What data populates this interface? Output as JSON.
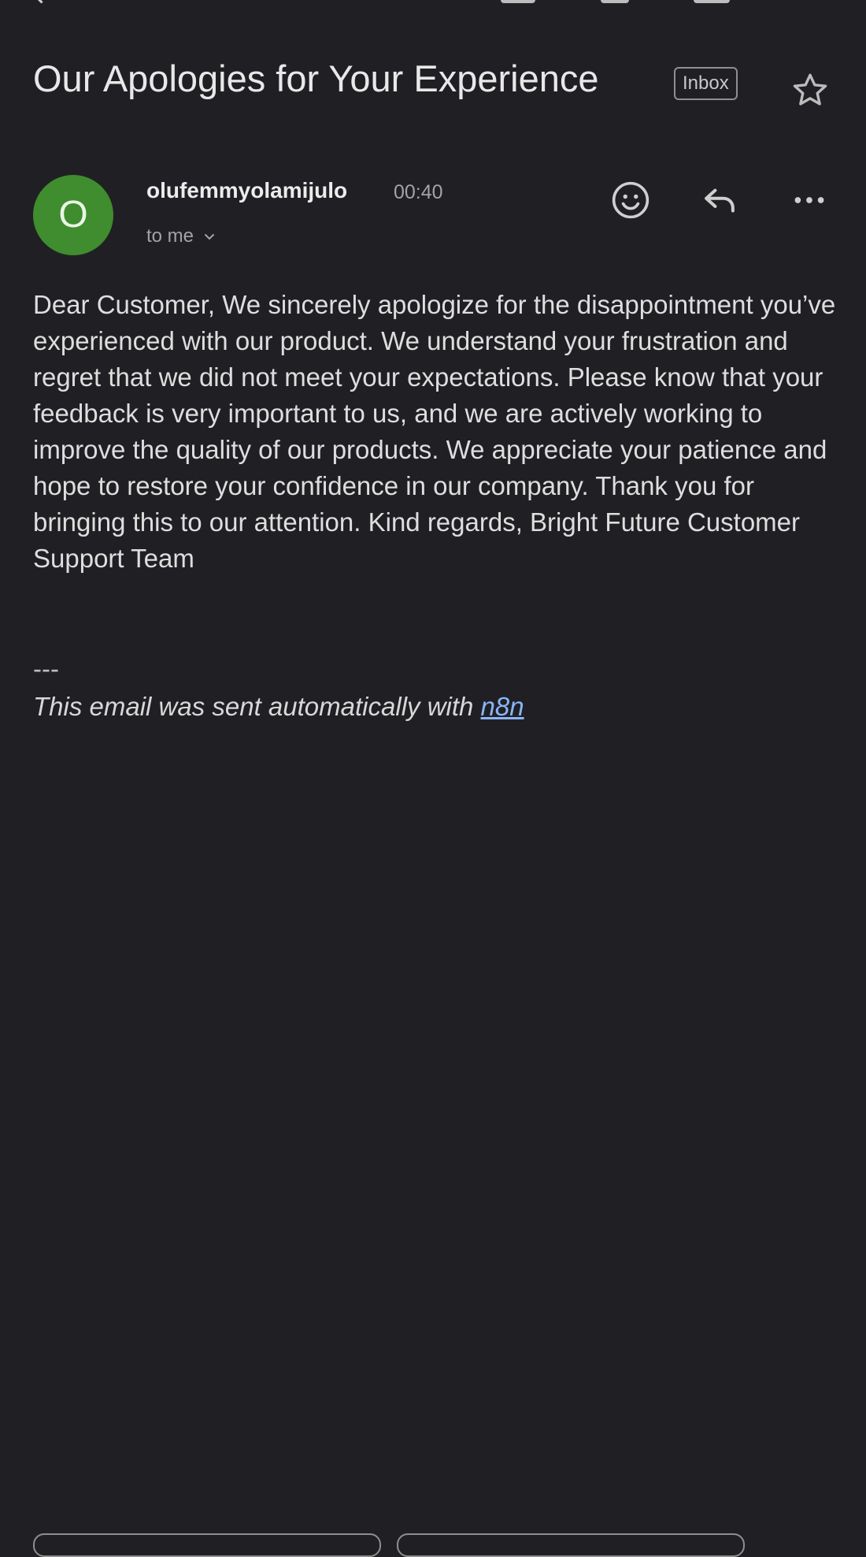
{
  "email": {
    "subject": "Our Apologies for Your Experience",
    "label": "Inbox",
    "sender": {
      "initial": "O",
      "name": "olufemmyolamijulo",
      "time": "00:40",
      "recipient": "to me"
    },
    "body": "Dear Customer, We sincerely apologize for the disappointment you’ve experienced with our product. We understand your frustration and regret that we did not meet your expectations. Please know that your feedback is very important to us, and we are actively working to improve the quality of our products. We appreciate your patience and hope to restore your confidence in our company. Thank you for bringing this to our attention. Kind regards, Bright Future Customer Support Team",
    "separator": "---",
    "footer": {
      "text": "This email was sent automatically with ",
      "link": "n8n"
    }
  },
  "icons": {
    "back": "back-arrow-icon",
    "star": "star-icon",
    "emoji": "emoji-reaction-icon",
    "reply": "reply-icon",
    "more": "more-options-icon",
    "dropdown": "chevron-down-icon"
  },
  "colors": {
    "background": "#202024",
    "avatar": "#3f8d2e",
    "link": "#8ab4f8"
  }
}
